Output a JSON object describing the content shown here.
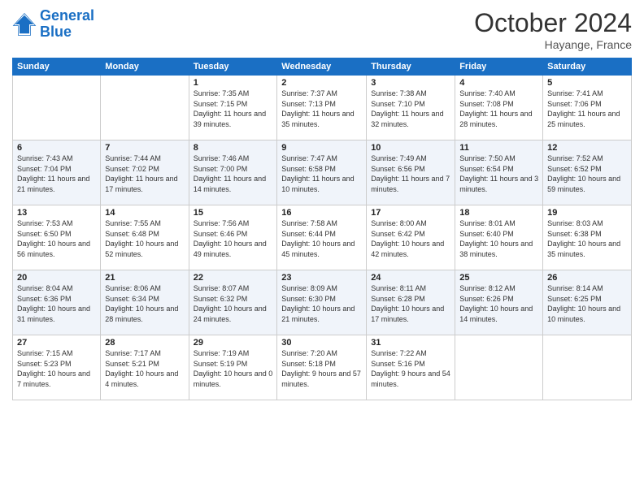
{
  "header": {
    "logo_line1": "General",
    "logo_line2": "Blue",
    "month": "October 2024",
    "location": "Hayange, France"
  },
  "weekdays": [
    "Sunday",
    "Monday",
    "Tuesday",
    "Wednesday",
    "Thursday",
    "Friday",
    "Saturday"
  ],
  "weeks": [
    [
      {
        "day": "",
        "sunrise": "",
        "sunset": "",
        "daylight": ""
      },
      {
        "day": "",
        "sunrise": "",
        "sunset": "",
        "daylight": ""
      },
      {
        "day": "1",
        "sunrise": "Sunrise: 7:35 AM",
        "sunset": "Sunset: 7:15 PM",
        "daylight": "Daylight: 11 hours and 39 minutes."
      },
      {
        "day": "2",
        "sunrise": "Sunrise: 7:37 AM",
        "sunset": "Sunset: 7:13 PM",
        "daylight": "Daylight: 11 hours and 35 minutes."
      },
      {
        "day": "3",
        "sunrise": "Sunrise: 7:38 AM",
        "sunset": "Sunset: 7:10 PM",
        "daylight": "Daylight: 11 hours and 32 minutes."
      },
      {
        "day": "4",
        "sunrise": "Sunrise: 7:40 AM",
        "sunset": "Sunset: 7:08 PM",
        "daylight": "Daylight: 11 hours and 28 minutes."
      },
      {
        "day": "5",
        "sunrise": "Sunrise: 7:41 AM",
        "sunset": "Sunset: 7:06 PM",
        "daylight": "Daylight: 11 hours and 25 minutes."
      }
    ],
    [
      {
        "day": "6",
        "sunrise": "Sunrise: 7:43 AM",
        "sunset": "Sunset: 7:04 PM",
        "daylight": "Daylight: 11 hours and 21 minutes."
      },
      {
        "day": "7",
        "sunrise": "Sunrise: 7:44 AM",
        "sunset": "Sunset: 7:02 PM",
        "daylight": "Daylight: 11 hours and 17 minutes."
      },
      {
        "day": "8",
        "sunrise": "Sunrise: 7:46 AM",
        "sunset": "Sunset: 7:00 PM",
        "daylight": "Daylight: 11 hours and 14 minutes."
      },
      {
        "day": "9",
        "sunrise": "Sunrise: 7:47 AM",
        "sunset": "Sunset: 6:58 PM",
        "daylight": "Daylight: 11 hours and 10 minutes."
      },
      {
        "day": "10",
        "sunrise": "Sunrise: 7:49 AM",
        "sunset": "Sunset: 6:56 PM",
        "daylight": "Daylight: 11 hours and 7 minutes."
      },
      {
        "day": "11",
        "sunrise": "Sunrise: 7:50 AM",
        "sunset": "Sunset: 6:54 PM",
        "daylight": "Daylight: 11 hours and 3 minutes."
      },
      {
        "day": "12",
        "sunrise": "Sunrise: 7:52 AM",
        "sunset": "Sunset: 6:52 PM",
        "daylight": "Daylight: 10 hours and 59 minutes."
      }
    ],
    [
      {
        "day": "13",
        "sunrise": "Sunrise: 7:53 AM",
        "sunset": "Sunset: 6:50 PM",
        "daylight": "Daylight: 10 hours and 56 minutes."
      },
      {
        "day": "14",
        "sunrise": "Sunrise: 7:55 AM",
        "sunset": "Sunset: 6:48 PM",
        "daylight": "Daylight: 10 hours and 52 minutes."
      },
      {
        "day": "15",
        "sunrise": "Sunrise: 7:56 AM",
        "sunset": "Sunset: 6:46 PM",
        "daylight": "Daylight: 10 hours and 49 minutes."
      },
      {
        "day": "16",
        "sunrise": "Sunrise: 7:58 AM",
        "sunset": "Sunset: 6:44 PM",
        "daylight": "Daylight: 10 hours and 45 minutes."
      },
      {
        "day": "17",
        "sunrise": "Sunrise: 8:00 AM",
        "sunset": "Sunset: 6:42 PM",
        "daylight": "Daylight: 10 hours and 42 minutes."
      },
      {
        "day": "18",
        "sunrise": "Sunrise: 8:01 AM",
        "sunset": "Sunset: 6:40 PM",
        "daylight": "Daylight: 10 hours and 38 minutes."
      },
      {
        "day": "19",
        "sunrise": "Sunrise: 8:03 AM",
        "sunset": "Sunset: 6:38 PM",
        "daylight": "Daylight: 10 hours and 35 minutes."
      }
    ],
    [
      {
        "day": "20",
        "sunrise": "Sunrise: 8:04 AM",
        "sunset": "Sunset: 6:36 PM",
        "daylight": "Daylight: 10 hours and 31 minutes."
      },
      {
        "day": "21",
        "sunrise": "Sunrise: 8:06 AM",
        "sunset": "Sunset: 6:34 PM",
        "daylight": "Daylight: 10 hours and 28 minutes."
      },
      {
        "day": "22",
        "sunrise": "Sunrise: 8:07 AM",
        "sunset": "Sunset: 6:32 PM",
        "daylight": "Daylight: 10 hours and 24 minutes."
      },
      {
        "day": "23",
        "sunrise": "Sunrise: 8:09 AM",
        "sunset": "Sunset: 6:30 PM",
        "daylight": "Daylight: 10 hours and 21 minutes."
      },
      {
        "day": "24",
        "sunrise": "Sunrise: 8:11 AM",
        "sunset": "Sunset: 6:28 PM",
        "daylight": "Daylight: 10 hours and 17 minutes."
      },
      {
        "day": "25",
        "sunrise": "Sunrise: 8:12 AM",
        "sunset": "Sunset: 6:26 PM",
        "daylight": "Daylight: 10 hours and 14 minutes."
      },
      {
        "day": "26",
        "sunrise": "Sunrise: 8:14 AM",
        "sunset": "Sunset: 6:25 PM",
        "daylight": "Daylight: 10 hours and 10 minutes."
      }
    ],
    [
      {
        "day": "27",
        "sunrise": "Sunrise: 7:15 AM",
        "sunset": "Sunset: 5:23 PM",
        "daylight": "Daylight: 10 hours and 7 minutes."
      },
      {
        "day": "28",
        "sunrise": "Sunrise: 7:17 AM",
        "sunset": "Sunset: 5:21 PM",
        "daylight": "Daylight: 10 hours and 4 minutes."
      },
      {
        "day": "29",
        "sunrise": "Sunrise: 7:19 AM",
        "sunset": "Sunset: 5:19 PM",
        "daylight": "Daylight: 10 hours and 0 minutes."
      },
      {
        "day": "30",
        "sunrise": "Sunrise: 7:20 AM",
        "sunset": "Sunset: 5:18 PM",
        "daylight": "Daylight: 9 hours and 57 minutes."
      },
      {
        "day": "31",
        "sunrise": "Sunrise: 7:22 AM",
        "sunset": "Sunset: 5:16 PM",
        "daylight": "Daylight: 9 hours and 54 minutes."
      },
      {
        "day": "",
        "sunrise": "",
        "sunset": "",
        "daylight": ""
      },
      {
        "day": "",
        "sunrise": "",
        "sunset": "",
        "daylight": ""
      }
    ]
  ]
}
